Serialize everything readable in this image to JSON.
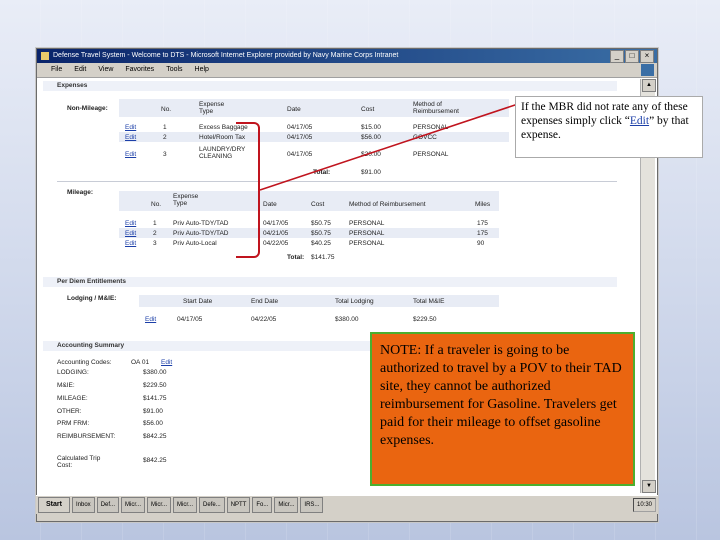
{
  "window": {
    "title": "Defense Travel System - Welcome to DTS - Microsoft Internet Explorer provided by Navy Marine Corps Intranet",
    "menu": [
      "File",
      "Edit",
      "View",
      "Favorites",
      "Tools",
      "Help"
    ]
  },
  "expenses": {
    "heading": "Expenses",
    "non_mileage": {
      "label": "Non-Mileage:",
      "headers": [
        "No.",
        "Expense Type",
        "Date",
        "Cost",
        "Method of Reimbursement"
      ],
      "rows": [
        {
          "action": "Edit",
          "no": "1",
          "type": "Excess Baggage",
          "date": "04/17/05",
          "cost": "$15.00",
          "method": "PERSONAL"
        },
        {
          "action": "Edit",
          "no": "2",
          "type": "Hotel/Room Tax",
          "date": "04/17/05",
          "cost": "$56.00",
          "method": "GOVCC"
        },
        {
          "action": "Edit",
          "no": "3",
          "type": "LAUNDRY/DRY CLEANING",
          "date": "04/17/05",
          "cost": "$20.00",
          "method": "PERSONAL"
        }
      ],
      "total_label": "Total:",
      "total_value": "$91.00"
    },
    "mileage": {
      "label": "Mileage:",
      "headers": [
        "No.",
        "Expense Type",
        "Date",
        "Cost",
        "Method of Reimbursement",
        "Miles"
      ],
      "rows": [
        {
          "action": "Edit",
          "no": "1",
          "type": "Priv Auto-TDY/TAD",
          "date": "04/17/05",
          "cost": "$50.75",
          "method": "PERSONAL",
          "miles": "175"
        },
        {
          "action": "Edit",
          "no": "2",
          "type": "Priv Auto-TDY/TAD",
          "date": "04/21/05",
          "cost": "$50.75",
          "method": "PERSONAL",
          "miles": "175"
        },
        {
          "action": "Edit",
          "no": "3",
          "type": "Priv Auto-Local",
          "date": "04/22/05",
          "cost": "$40.25",
          "method": "PERSONAL",
          "miles": "90"
        }
      ],
      "total_label": "Total:",
      "total_value": "$141.75"
    }
  },
  "per_diem": {
    "heading": "Per Diem Entitlements",
    "label": "Lodging / M&IE:",
    "headers": [
      "Start Date",
      "End Date",
      "Total Lodging",
      "Total M&IE"
    ],
    "row": {
      "action": "Edit",
      "start": "04/17/05",
      "end": "04/22/05",
      "lodging": "$380.00",
      "mie": "$229.50"
    }
  },
  "accounting": {
    "heading": "Accounting Summary",
    "codes_label": "Accounting Codes:",
    "codes_value": "OA 01",
    "codes_edit": "Edit",
    "lines": [
      {
        "label": "LODGING:",
        "value": "$380.00"
      },
      {
        "label": "M&IE:",
        "value": "$229.50"
      },
      {
        "label": "MILEAGE:",
        "value": "$141.75"
      },
      {
        "label": "OTHER:",
        "value": "$91.00"
      },
      {
        "label": "PRM FRM:",
        "value": "$56.00"
      },
      {
        "label": "REIMBURSEMENT:",
        "value": "$842.25"
      }
    ],
    "calc_label": "Calculated Trip Cost:",
    "calc_value": "$842.25"
  },
  "taskbar": {
    "start": "Start",
    "items": [
      "Inbox",
      "Def...",
      "Micr...",
      "Micr...",
      "Micr...",
      "Defe...",
      "NPTT",
      "Fo...",
      "Micr...",
      "IRS..."
    ],
    "clock": "10:30"
  },
  "callouts": {
    "edit_note": "If the MBR did not rate any of these expenses simply click “Edit” by that expense.",
    "edit_note_link": "Edit",
    "pov_note": "NOTE: If a traveler is going to be authorized to travel by a POV to their TAD site, they cannot be authorized reimbursement for Gasoline. Travelers get paid for their mileage to offset gasoline expenses."
  },
  "colors": {
    "callout_orange": "#ea6510",
    "callout_border": "#4caf2f",
    "bracket_red": "#c0141e",
    "title_blue": "#0a246a"
  }
}
